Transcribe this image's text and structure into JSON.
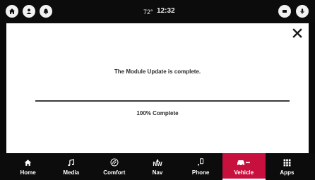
{
  "status_bar": {
    "temperature": "72°",
    "time": "12:32"
  },
  "dialog": {
    "message": "The Module Update is complete.",
    "progress_percent": 100,
    "progress_text": "100% Complete"
  },
  "nav": {
    "home": "Home",
    "media": "Media",
    "comfort": "Comfort",
    "nav_direction": "NW",
    "nav": "Nav",
    "phone": "Phone",
    "vehicle": "Vehicle",
    "apps": "Apps"
  },
  "colors": {
    "active_tab": "#c8103e",
    "bar_background": "#0c0c0c",
    "panel_background": "#ffffff"
  }
}
